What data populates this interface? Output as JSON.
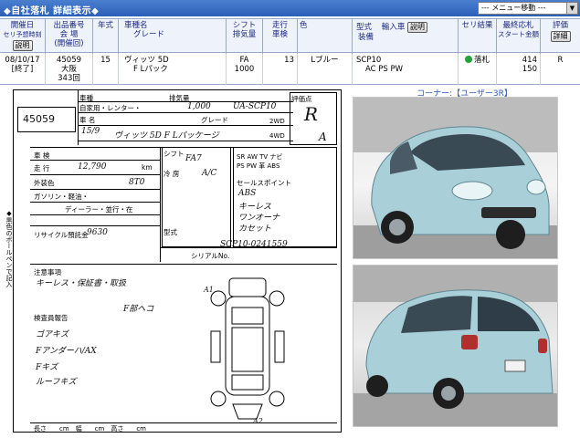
{
  "title": "◆自社落札 詳細表示◆",
  "menu": "--- メニュー移動 ---",
  "header": {
    "col1": [
      "開催日",
      "セリ予想時刻"
    ],
    "col1_btn": "説明",
    "col2": [
      "出品番号",
      "会 場",
      "(開催回)"
    ],
    "col3": "年式",
    "col4": [
      "車種名",
      "グレード"
    ],
    "col5": [
      "シフト",
      "排気量"
    ],
    "col6": [
      "走行",
      "車検"
    ],
    "col7": "色",
    "col8": [
      "型式",
      "装備"
    ],
    "col8b": "輸入車",
    "col8_btn": "説明",
    "col9": "セリ結果",
    "col10": [
      "最終応札",
      "スタート金額"
    ],
    "col11": "評価",
    "col11_btn": "詳細"
  },
  "record": {
    "date": "08/10/17",
    "status": "[終了]",
    "lot": "45059",
    "venue": "大阪",
    "session": "343回",
    "year": "15",
    "model": "ヴィッツ 5D",
    "grade": "F Lパック",
    "shift": "FA",
    "displacement": "1000",
    "mileage": "13",
    "inspection": "",
    "color": "Lブルー",
    "type": "SCP10",
    "equipment": "AC PS PW",
    "result": "落札",
    "final_bid": "414",
    "start_price": "150",
    "rating": "R"
  },
  "sheet": {
    "lot": "45059",
    "labels": {
      "car_type": "車種",
      "own": "自家用・レンター・",
      "displacement_lbl": "排気量",
      "name": "車 名",
      "grade": "グレード",
      "shift": "シフト",
      "ac": "冷 房",
      "inspection": "車 検",
      "mileage": "走 行",
      "color": "外装色",
      "fuel": "ガソリン・軽油・",
      "history": "ディーラー・並行・在",
      "recycle": "リサイクル預託金",
      "notice": "注意事項",
      "inspector": "検査員報告",
      "equipment_lbl": "セールスポイント",
      "model_lbl": "型式",
      "serial": "シリアルNo.",
      "rating_lbl": "評価点",
      "km": "km"
    },
    "handwriting": {
      "displacement": "1,000",
      "type_code": "UA-SCP10",
      "year": "15/9",
      "name": "ヴィッツ 5D F Lパッケージ",
      "shift": "FA7",
      "ac": "A/C",
      "mileage": "12,790",
      "color_code": "8T0",
      "recycle": "9630",
      "rating": "R",
      "interior": "A",
      "points": [
        "ABS",
        "キーレス",
        "ワンオーナ",
        "カセット"
      ],
      "serial": "SCP10-0241559",
      "notice": "キーレス・保証書・取扱",
      "inspector": [
        "ゴアキズ",
        "Fアンダーハ/AX",
        "Fキズ",
        "ルーフキズ"
      ],
      "damage": [
        "A1",
        "A2",
        "F部ヘコ"
      ]
    }
  },
  "photo_caption": "コーナー:【ユーザー3R】",
  "colors": {
    "titlebar": "#2c5fb8",
    "header_bg": "#eef2fb",
    "header_text": "#1c2a80",
    "car_body": "#a9cfd8",
    "result_dot": "#22a33a"
  }
}
